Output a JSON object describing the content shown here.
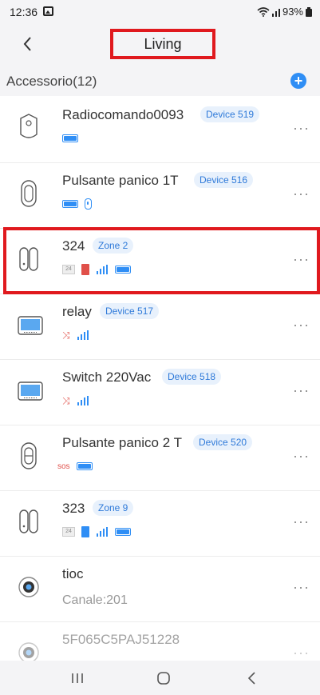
{
  "status_bar": {
    "time": "12:36",
    "battery": "93%",
    "icons": [
      "gallery-icon",
      "wifi-icon",
      "signal-icon",
      "battery-icon"
    ]
  },
  "header": {
    "title": "Living",
    "back_icon": "chevron-left-icon"
  },
  "section": {
    "title": "Accessorio(12)",
    "add_icon": "plus-icon",
    "add_label": "+"
  },
  "devices": [
    {
      "name": "Radiocomando0093",
      "badge": "Device 519",
      "icon": "remote-control-icon",
      "status_icons": [
        "battery-icon"
      ]
    },
    {
      "name": "Pulsante panico 1T",
      "badge": "Device 516",
      "icon": "panic-button-icon",
      "status_icons": [
        "battery-icon",
        "bluetooth-icon"
      ]
    },
    {
      "name": "324",
      "badge": "Zone 2",
      "icon": "door-sensor-icon",
      "status_icons": [
        "24h-icon",
        "door-open-icon",
        "signal-icon",
        "battery-icon"
      ],
      "badge_24": "24"
    },
    {
      "name": "relay",
      "badge": "Device 517",
      "icon": "relay-panel-icon",
      "status_icons": [
        "relay-icon",
        "signal-icon"
      ],
      "relay_glyph": "⤨"
    },
    {
      "name": "Switch 220Vac",
      "badge": "Device 518",
      "icon": "switch-panel-icon",
      "status_icons": [
        "relay-icon",
        "signal-icon"
      ],
      "relay_glyph": "⤨"
    },
    {
      "name": "Pulsante panico 2 T",
      "badge": "Device 520",
      "icon": "panic-button-2-icon",
      "status_icons": [
        "sos-icon",
        "battery-icon"
      ],
      "sos_text": "sos"
    },
    {
      "name": "323",
      "badge": "Zone 9",
      "icon": "door-sensor-icon",
      "status_icons": [
        "24h-icon",
        "door-closed-icon",
        "signal-icon",
        "battery-icon"
      ],
      "badge_24": "24"
    },
    {
      "name": "tioc",
      "channel": "Canale:201",
      "icon": "camera-icon"
    },
    {
      "name": "5F065C5PAJ51228",
      "icon": "camera-icon"
    }
  ],
  "more_label": "···",
  "colors": {
    "accent": "#2f8ef5",
    "highlight": "#e0191e",
    "badge_bg": "#e8f1fc",
    "alert": "#e0504a"
  },
  "nav_bar": {
    "icons": [
      "recent-apps-icon",
      "home-icon",
      "back-icon"
    ]
  }
}
